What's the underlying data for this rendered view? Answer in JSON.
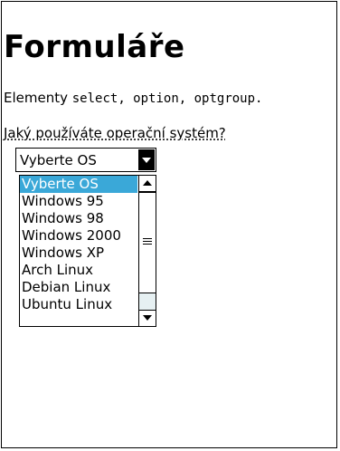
{
  "page": {
    "title": "Formuláře",
    "description_prefix": "Elementy ",
    "description_code": "select, option, optgroup.",
    "question": "Jaký používáte operační systém?"
  },
  "select": {
    "selected_value": "Vyberte OS",
    "options": [
      "Vyberte OS",
      "Windows 95",
      "Windows 98",
      "Windows 2000",
      "Windows XP",
      "Arch Linux",
      "Debian Linux",
      "Ubuntu Linux"
    ]
  }
}
